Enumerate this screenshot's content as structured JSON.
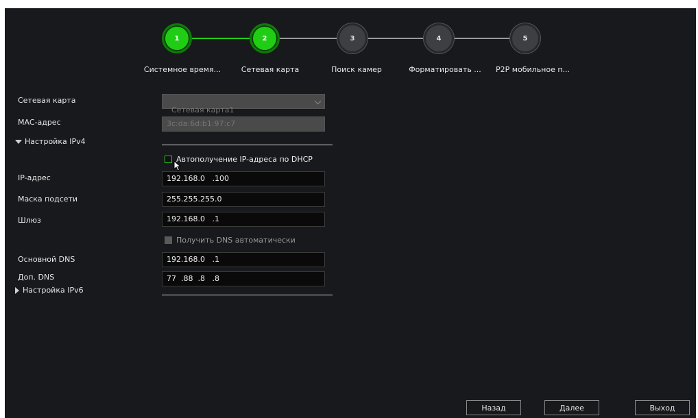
{
  "colors": {
    "accent_green": "#1fce14",
    "background": "#17191c"
  },
  "wizard": {
    "steps": [
      {
        "number": "1",
        "label": "Системное время...",
        "state": "done"
      },
      {
        "number": "2",
        "label": "Сетевая карта",
        "state": "current"
      },
      {
        "number": "3",
        "label": "Поиск камер",
        "state": "pending"
      },
      {
        "number": "4",
        "label": "Форматировать ...",
        "state": "pending"
      },
      {
        "number": "5",
        "label": "P2P мобильное п...",
        "state": "pending"
      }
    ]
  },
  "form": {
    "nic_label": "Сетевая карта",
    "nic_value": "Сетевая карта1",
    "mac_label": "MAC-адрес",
    "mac_value": "3c:da:6d:b1:97:c7",
    "ipv4_section": "Настройка IPv4",
    "dhcp_label": "Автополучение IP-адреса по DHCP",
    "ip_label": "IP-адрес",
    "ip_value": "192.168.0   .100",
    "mask_label": "Маска подсети",
    "mask_value": "255.255.255.0",
    "gateway_label": "Шлюз",
    "gateway_value": "192.168.0   .1",
    "dns_auto_label": "Получить DNS автоматически",
    "dns_primary_label": "Основной DNS",
    "dns_primary_value": "192.168.0   .1",
    "dns_secondary_label": "Доп. DNS",
    "dns_secondary_value": "77  .88  .8   .8",
    "ipv6_section": "Настройка IPv6"
  },
  "buttons": {
    "back": "Назад",
    "next": "Далее",
    "exit": "Выход"
  }
}
